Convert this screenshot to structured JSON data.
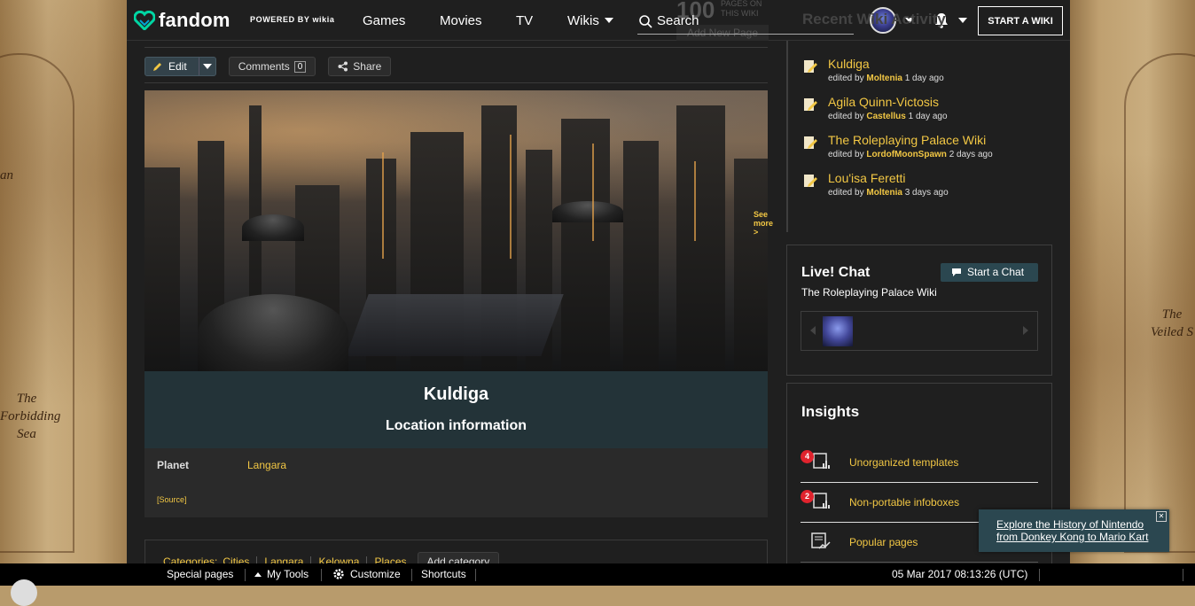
{
  "nav": {
    "logo_text": "fandom",
    "powered_by": "POWERED BY wikia",
    "links": [
      "Games",
      "Movies",
      "TV",
      "Wikis"
    ],
    "search_label": "Search",
    "start_wiki": "START A WIKI"
  },
  "header": {
    "page_title": "Kuldiga",
    "page_count": "100",
    "page_count_label": "PAGES ON THIS WIKI",
    "add_page": "Add New Page"
  },
  "actions": {
    "edit": "Edit",
    "comments": "Comments",
    "comments_count": "0",
    "share": "Share"
  },
  "infobox": {
    "title": "Kuldiga",
    "subtitle": "Location information",
    "planet_label": "Planet",
    "planet_value": "Langara",
    "source": "[Source]"
  },
  "categories": {
    "label": "Categories:",
    "items": [
      "Cities",
      "Langara",
      "Kelowna",
      "Places"
    ],
    "add": "Add category"
  },
  "rail": {
    "activity_title": "Recent Wiki Activity",
    "activity": [
      {
        "page": "Kuldiga",
        "prefix": "edited by",
        "user": "Moltenia",
        "time": "1 day ago"
      },
      {
        "page": "Agila Quinn-Victosis",
        "prefix": "edited by",
        "user": "Castellus",
        "time": "1 day ago"
      },
      {
        "page": "The Roleplaying Palace Wiki",
        "prefix": "edited by",
        "user": "LordofMoonSpawn",
        "time": "2 days ago"
      },
      {
        "page": "Lou'isa Feretti",
        "prefix": "edited by",
        "user": "Moltenia",
        "time": "3 days ago"
      }
    ],
    "see_more": "See more >",
    "chat_title": "Live! Chat",
    "chat_wiki": "The Roleplaying Palace Wiki",
    "chat_button": "Start a Chat",
    "insights_title": "Insights",
    "insights": [
      {
        "label": "Unorganized templates",
        "badge": "4"
      },
      {
        "label": "Non-portable infoboxes",
        "badge": "2"
      },
      {
        "label": "Popular pages",
        "badge": ""
      }
    ]
  },
  "toolbar": {
    "special_pages": "Special pages",
    "my_tools": "My Tools",
    "customize": "Customize",
    "shortcuts": "Shortcuts",
    "timestamp": "05 Mar 2017 08:13:26 (UTC)"
  },
  "promo": {
    "text": "Explore the History of Nintendo from Donkey Kong to Mario Kart"
  },
  "map_labels": [
    "an",
    "The Forbidding Sea",
    "The Veiled S"
  ],
  "colors": {
    "link": "#f2c744",
    "nav_bg": "#1f1f1f",
    "infobox_header": "#233338",
    "badge": "#e0232d"
  }
}
